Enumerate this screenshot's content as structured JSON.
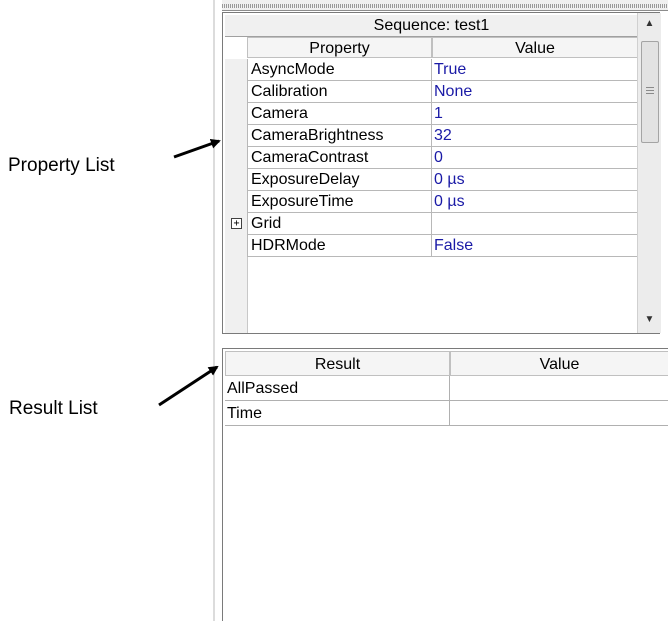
{
  "annotations": {
    "property_list": "Property List",
    "result_list": "Result List"
  },
  "property_panel": {
    "caption": "Sequence: test1",
    "columns": [
      "Property",
      "Value"
    ],
    "rows": [
      {
        "name": "AsyncMode",
        "value": "True"
      },
      {
        "name": "Calibration",
        "value": "None"
      },
      {
        "name": "Camera",
        "value": "1"
      },
      {
        "name": "CameraBrightness",
        "value": "32"
      },
      {
        "name": "CameraContrast",
        "value": "0"
      },
      {
        "name": "ExposureDelay",
        "value": "0 µs"
      },
      {
        "name": "ExposureTime",
        "value": "0 µs"
      },
      {
        "name": "Grid",
        "value": "",
        "expander": "+"
      },
      {
        "name": "HDRMode",
        "value": "False"
      }
    ]
  },
  "result_panel": {
    "columns": [
      "Result",
      "Value"
    ],
    "rows": [
      {
        "name": "AllPassed",
        "value": ""
      },
      {
        "name": "Time",
        "value": ""
      }
    ]
  },
  "colors": {
    "value_text": "#1a1aa6",
    "header_bg": "#f5f5f5",
    "grid_line": "#b8b8b8"
  }
}
